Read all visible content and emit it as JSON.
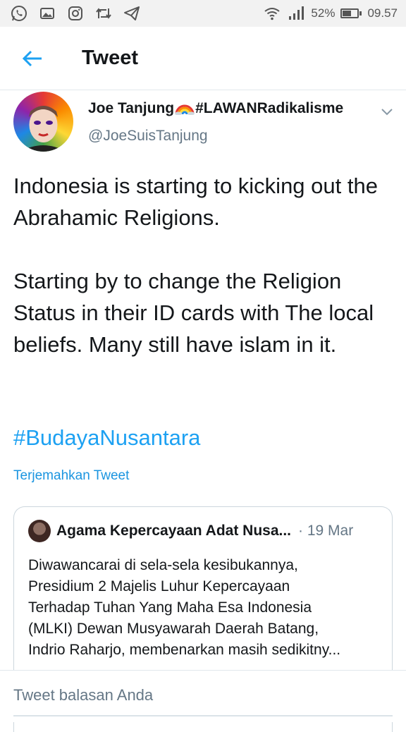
{
  "status_bar": {
    "battery_percent": "52%",
    "battery_level": 0.52,
    "time": "09.57",
    "left_icons": [
      "whatsapp-icon",
      "gallery-icon",
      "instagram-icon",
      "retweet-icon",
      "telegram-icon"
    ],
    "right_icons": [
      "wifi-icon",
      "signal-icon",
      "battery-icon"
    ]
  },
  "header": {
    "title": "Tweet",
    "back_icon": "arrow-left-icon"
  },
  "tweet": {
    "author_name": "Joe Tanjung",
    "author_name_suffix": "#LAWANRadikalisme",
    "author_handle": "@JoeSuisTanjung",
    "paragraph1": "Indonesia is starting to kicking out the Abrahamic Religions.",
    "paragraph2": "Starting by to change the Religion Status in their ID cards with The local beliefs. Many still have islam in it.",
    "hashtag": "#BudayaNusantara",
    "translate_label": "Terjemahkan Tweet"
  },
  "quoted_tweet": {
    "author": "Agama Kepercayaan Adat Nusa...",
    "date": "· 19 Mar",
    "text": "Diwawancarai di sela-sela kesibukannya,\nPresidium 2 Majelis Luhur Kepercayaan\nTerhadap Tuhan Yang Maha Esa Indonesia\n(MLKI) Dewan Musyawarah Daerah Batang,\nIndrio Raharjo, membenarkan masih sedikitny..."
  },
  "reply": {
    "placeholder": "Tweet balasan Anda"
  },
  "colors": {
    "accent": "#1da1f2",
    "link": "#1b95e0",
    "text": "#14171a",
    "muted": "#657786"
  }
}
